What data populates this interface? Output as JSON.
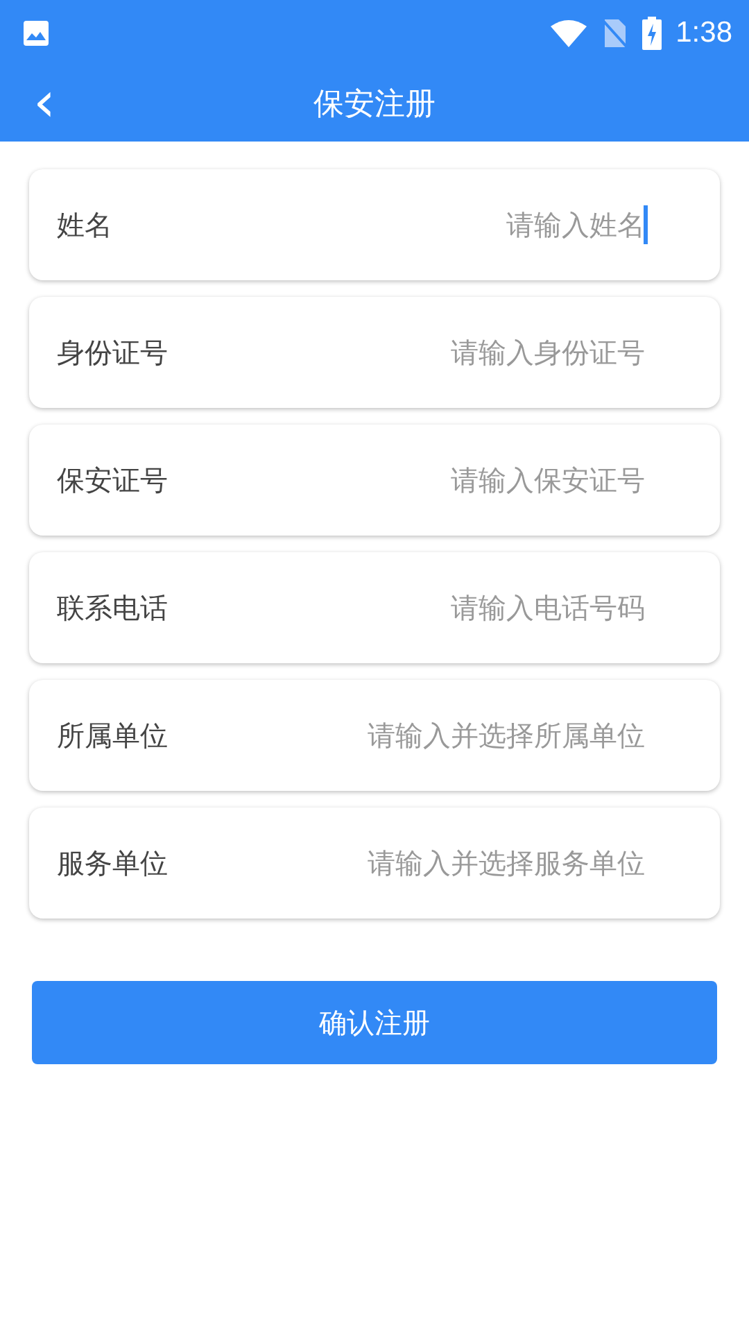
{
  "status_bar": {
    "time": "1:38"
  },
  "app_bar": {
    "back": "‹",
    "title": "保安注册"
  },
  "fields": [
    {
      "label": "姓名",
      "placeholder": "请输入姓名",
      "focused": true
    },
    {
      "label": "身份证号",
      "placeholder": "请输入身份证号",
      "focused": false
    },
    {
      "label": "保安证号",
      "placeholder": "请输入保安证号",
      "focused": false
    },
    {
      "label": "联系电话",
      "placeholder": "请输入电话号码",
      "focused": false
    },
    {
      "label": "所属单位",
      "placeholder": "请输入并选择所属单位",
      "focused": false
    },
    {
      "label": "服务单位",
      "placeholder": "请输入并选择服务单位",
      "focused": false
    }
  ],
  "submit": "确认注册"
}
